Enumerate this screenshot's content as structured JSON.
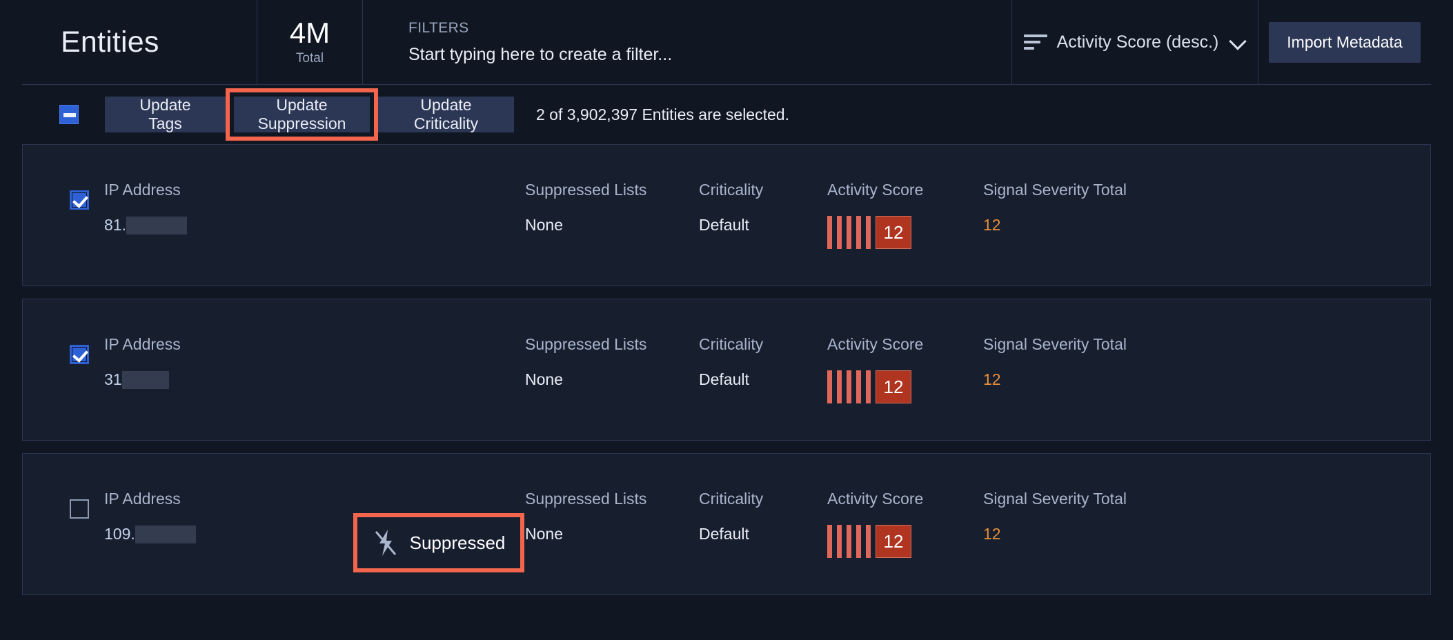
{
  "header": {
    "title": "Entities",
    "total_value": "4M",
    "total_label": "Total",
    "filters_label": "FILTERS",
    "filters_placeholder": "Start typing here to create a filter...",
    "filters_value": "",
    "sort_label": "Activity Score (desc.)",
    "sort_icon": "sort-descending-icon",
    "chevron_icon": "chevron-down-icon",
    "import_label": "Import Metadata"
  },
  "action_bar": {
    "select_all_state": "indeterminate",
    "buttons": [
      {
        "label": "Update Tags",
        "highlighted": false
      },
      {
        "label": "Update Suppression",
        "highlighted": true
      },
      {
        "label": "Update Criticality",
        "highlighted": false
      }
    ],
    "selection_text": "2 of 3,902,397 Entities are selected."
  },
  "columns": {
    "entity_label": "IP Address",
    "suppressed_lists_label": "Suppressed Lists",
    "criticality_label": "Criticality",
    "activity_score_label": "Activity Score",
    "signal_severity_label": "Signal Severity Total"
  },
  "rows": [
    {
      "checked": true,
      "entity_type": "IP Address",
      "ip_prefix": "81.",
      "ip_redacted_width": 88,
      "suppressed_badge": null,
      "suppressed_lists": "None",
      "criticality": "Default",
      "activity_score": "12",
      "activity_bars": 5,
      "signal_severity_total": "12"
    },
    {
      "checked": true,
      "entity_type": "IP Address",
      "ip_prefix": "31",
      "ip_redacted_width": 68,
      "suppressed_badge": null,
      "suppressed_lists": "None",
      "criticality": "Default",
      "activity_score": "12",
      "activity_bars": 5,
      "signal_severity_total": "12"
    },
    {
      "checked": false,
      "entity_type": "IP Address",
      "ip_prefix": "109.",
      "ip_redacted_width": 88,
      "suppressed_badge": "Suppressed",
      "suppressed_badge_icon": "bolt-slash-icon",
      "suppressed_lists": "None",
      "criticality": "Default",
      "activity_score": "12",
      "activity_bars": 5,
      "signal_severity_total": "12"
    }
  ],
  "colors": {
    "background": "#101622",
    "row_background": "#171e2e",
    "accent_blue": "#2f61d6",
    "highlight_red": "#f4654e",
    "score_box": "#b03520",
    "score_bar": "#e0685a",
    "signal_orange": "#e8903a"
  }
}
